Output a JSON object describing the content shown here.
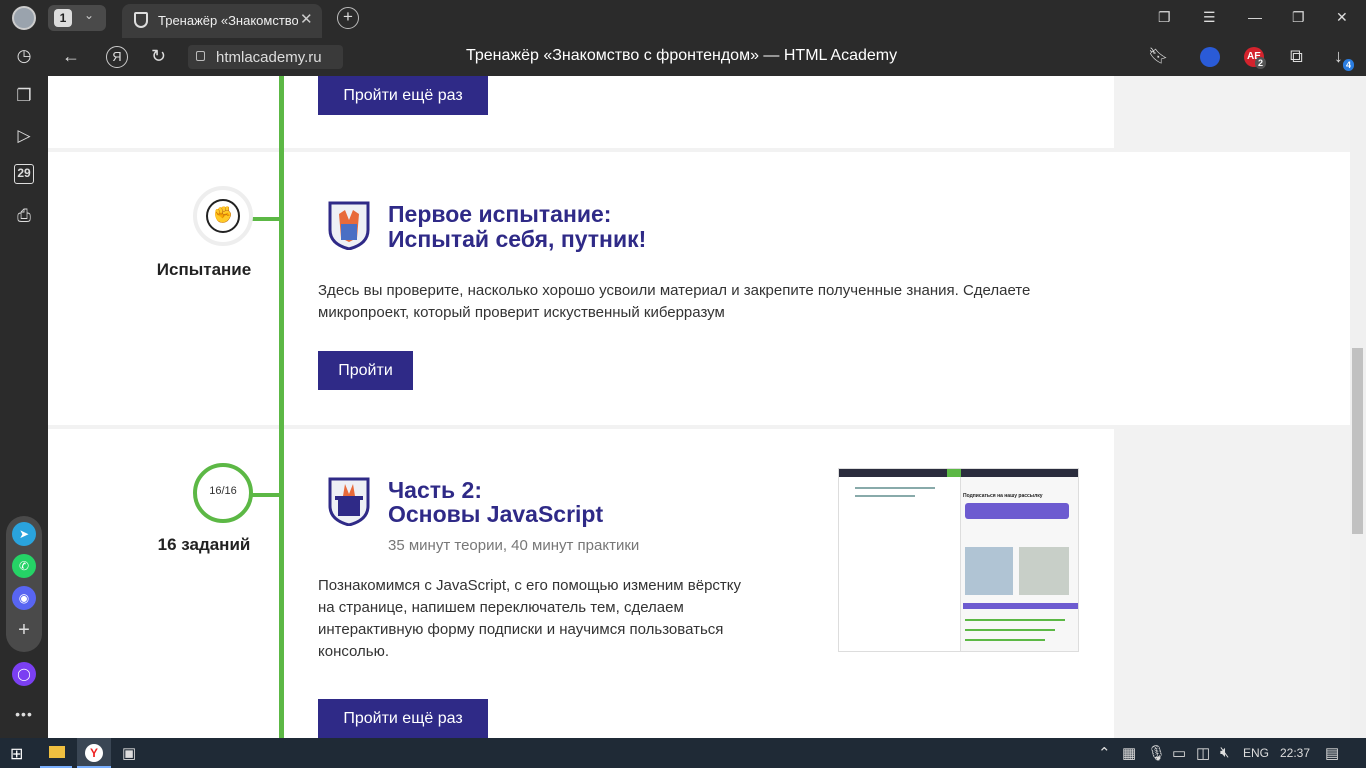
{
  "browser": {
    "tab_count": "1",
    "tab_title": "Тренажёр «Знакомство",
    "url": "htmlacademy.ru",
    "page_title": "Тренажёр «Знакомство с фронтендом» — HTML Academy",
    "ext_badge_1": "2",
    "download_badge": "4",
    "sidebar_date": "29"
  },
  "sections": {
    "prev_button": "Пройти ещё раз",
    "trial": {
      "status_label": "Испытание",
      "title_line1": "Первое испытание:",
      "title_line2": "Испытай себя, путник!",
      "description_line1": "Здесь вы проверите, насколько хорошо усвоили материал и закрепите полученные знания. Сделаете",
      "description_line2": "микропроект, который проверит искуственный киберразум",
      "button": "Пройти"
    },
    "part2": {
      "progress": "16/16",
      "status_label": "16 заданий",
      "title_line1": "Часть 2:",
      "title_line2": "Основы JavaScript",
      "duration": "35 минут теории, 40 минут практики",
      "description_line1": "Познакомимся с JavaScript, с его помощью изменим вёрстку",
      "description_line2": "на странице, напишем переключатель тем, сделаем",
      "description_line3": "интерактивную форму подписки и научимся пользоваться",
      "description_line4": "консолью.",
      "button": "Пройти ещё раз",
      "preview_heading": "Подписаться на нашу рассылку"
    }
  },
  "taskbar": {
    "lang": "ENG",
    "time": "22:37"
  }
}
